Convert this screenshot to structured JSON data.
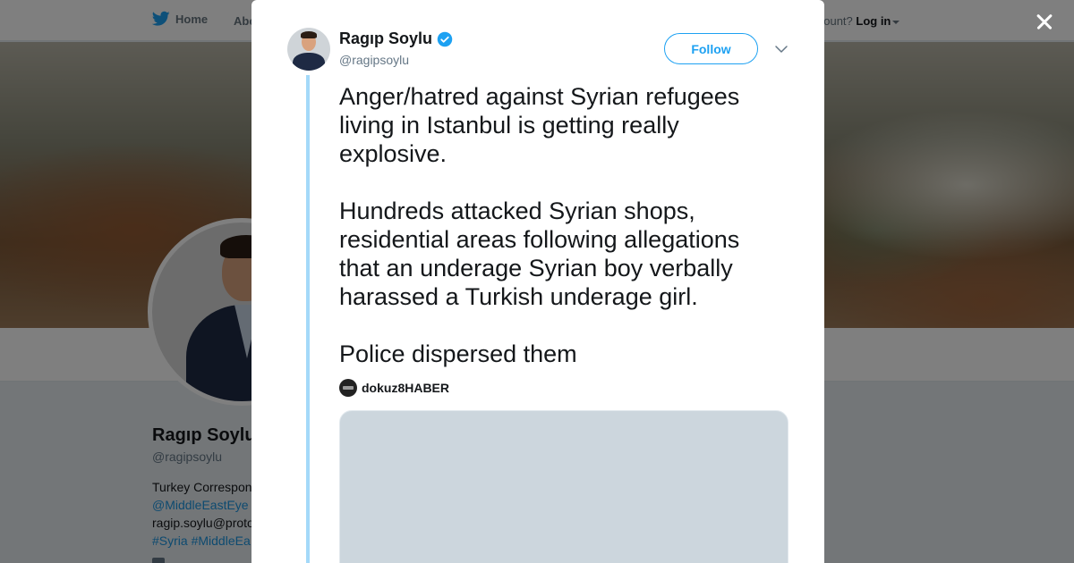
{
  "background_page": {
    "nav": {
      "home_label": "Home",
      "about_label": "Abo",
      "account_prompt": "account?",
      "login_label": "Log in"
    },
    "profile": {
      "name": "Ragıp Soylu",
      "handle": "@ragipsoylu",
      "bio_line1": "Turkey Correspon",
      "bio_mention": "@MiddleEastEye",
      "bio_email": "ragip.soylu@proto",
      "bio_hashtags": "#Syria #MiddleEa"
    }
  },
  "tweet": {
    "author_name": "Ragıp Soylu",
    "author_handle": "@ragipsoylu",
    "verified": true,
    "follow_label": "Follow",
    "text": "Anger/hatred against Syrian refugees living in Istanbul is getting really explosive.\n\nHundreds attacked Syrian shops, residential areas following allegations that an underage Syrian boy verbally harassed a Turkish underage girl.\n\nPolice dispersed them",
    "media_source": "dokuz8HABER"
  },
  "colors": {
    "accent": "#1da1f2",
    "thread_line": "#a4d9f9",
    "media_placeholder": "#ccd6dd"
  }
}
